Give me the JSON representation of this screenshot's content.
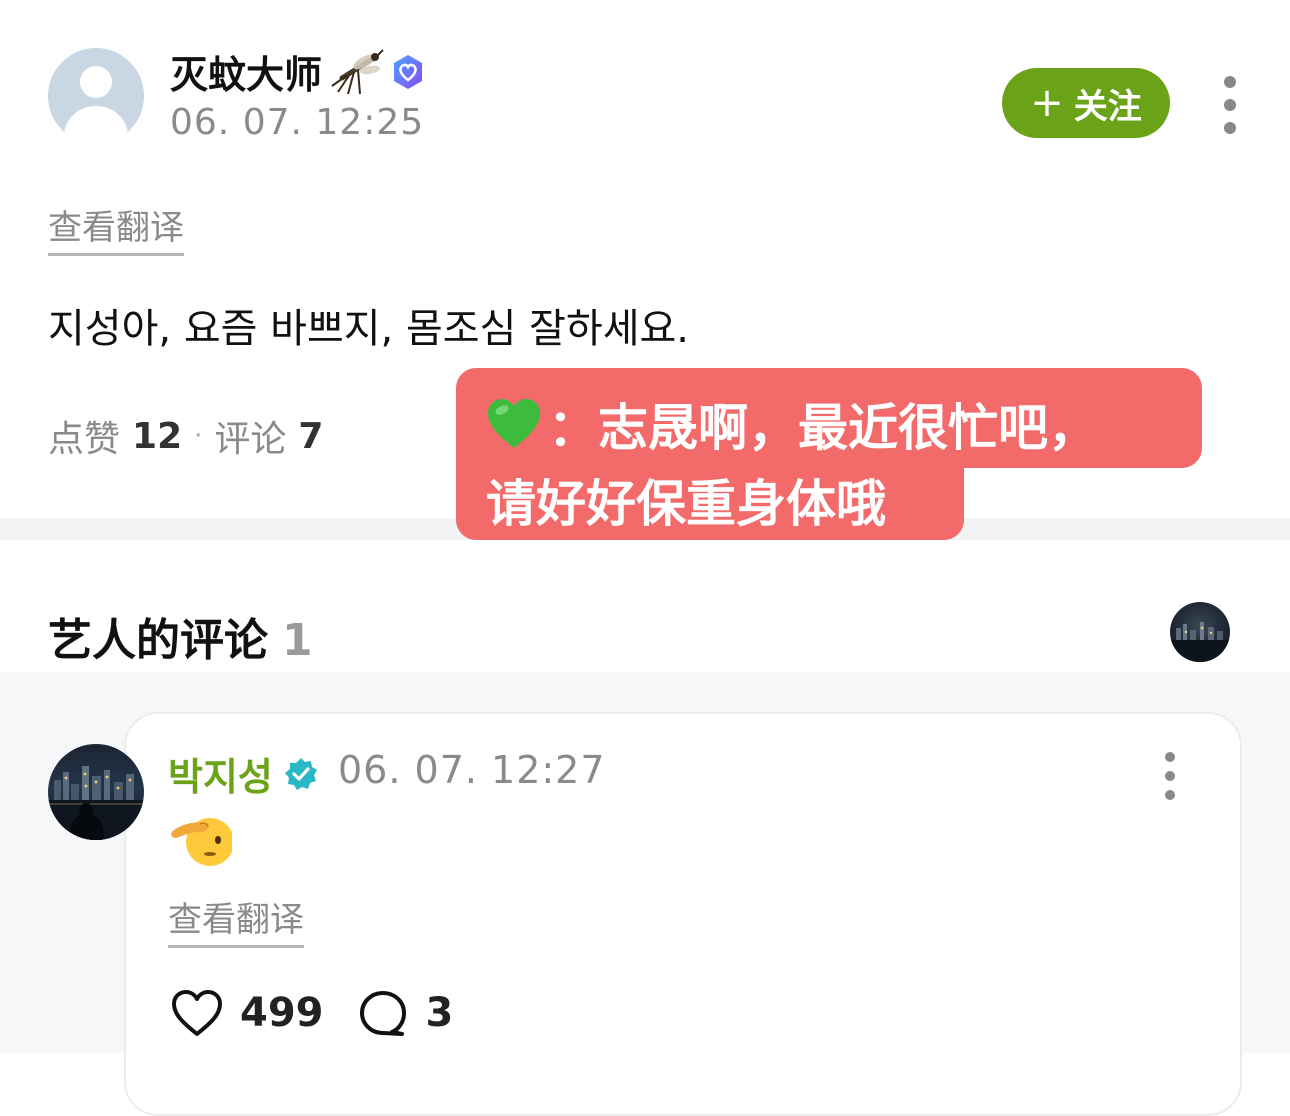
{
  "post": {
    "username": "灭蚊大师",
    "timestamp": "06. 07. 12:25",
    "follow_label": "关注",
    "translate_label": "查看翻译",
    "text": "지성아, 요즘 바쁘지, 몸조심 잘하세요.",
    "likes_label": "点赞",
    "likes_count": "12",
    "separator": "·",
    "comments_label": "评论",
    "comments_count": "7"
  },
  "overlay": {
    "line1": "：志晟啊，最近很忙吧，",
    "line2": "请好好保重身体哦",
    "color": "#f36a6a",
    "icon": "green-heart-icon"
  },
  "artist_comments": {
    "title": "艺人的评论",
    "count": "1",
    "comment": {
      "name": "박지성",
      "timestamp": "06. 07. 12:27",
      "emoji": "saluting-face",
      "translate_label": "查看翻译",
      "likes": "499",
      "replies": "3"
    }
  },
  "colors": {
    "accent_green": "#6aa318",
    "meta_grey": "#8a8a8a",
    "verified_teal": "#2bb7c6",
    "badge_purple": "#7b5cf0"
  }
}
